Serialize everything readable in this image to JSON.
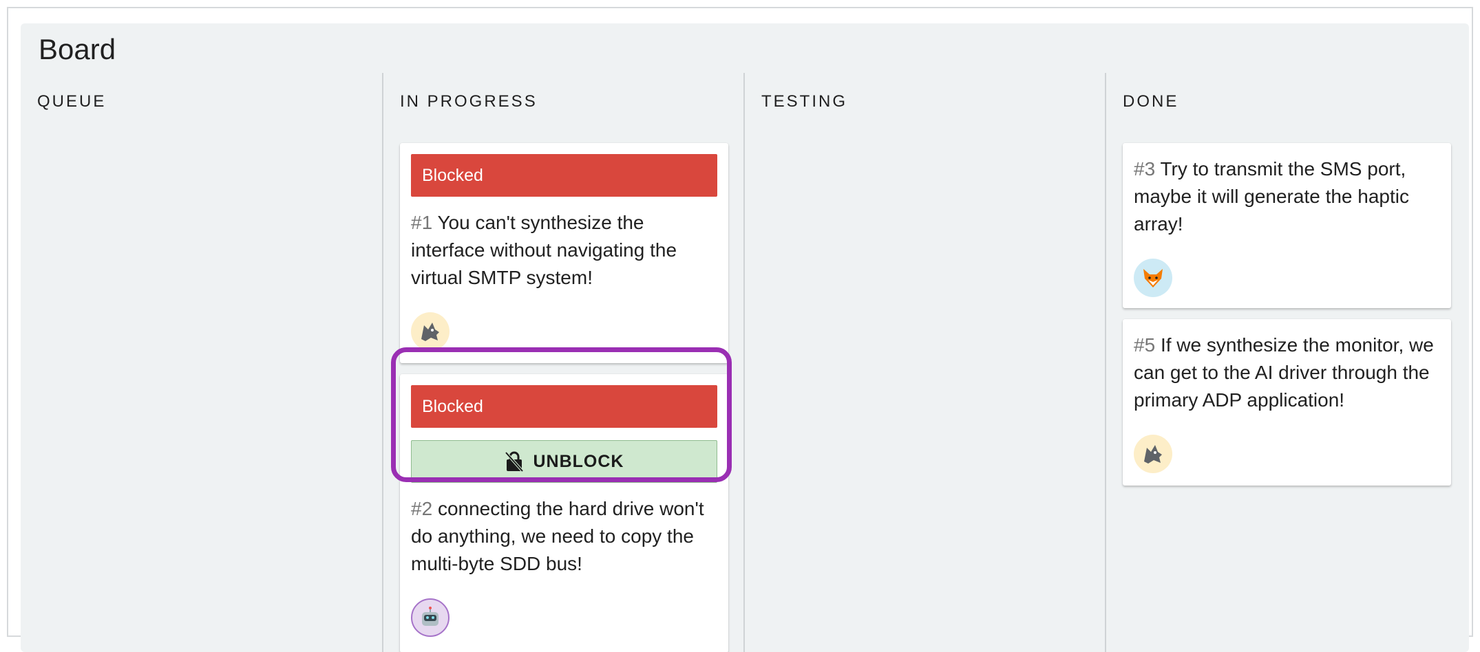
{
  "board": {
    "title": "Board"
  },
  "columns": [
    {
      "title": "QUEUE"
    },
    {
      "title": "IN PROGRESS"
    },
    {
      "title": "TESTING"
    },
    {
      "title": "DONE"
    }
  ],
  "cards": {
    "c1": {
      "badge": "Blocked",
      "number": "#1",
      "text": "You can't synthesize the interface without navigating the virtual SMTP system!",
      "avatar": "wolf-icon"
    },
    "c2": {
      "badge": "Blocked",
      "unblock_label": "UNBLOCK",
      "number": "#2",
      "text": "connecting the hard drive won't do anything, we need to copy the multi-byte SDD bus!",
      "avatar": "robot-icon"
    },
    "c3": {
      "number": "#3",
      "text": "Try to transmit the SMS port, maybe it will generate the haptic array!",
      "avatar": "fox-icon"
    },
    "c5": {
      "number": "#5",
      "text": "If we synthesize the monitor, we can get to the AI driver through the primary ADP application!",
      "avatar": "wolf-icon"
    }
  },
  "colors": {
    "blocked": "#d9473d",
    "unblock": "#cfe8cf",
    "highlight": "#9a2fb3",
    "board_bg": "#eff2f3"
  }
}
